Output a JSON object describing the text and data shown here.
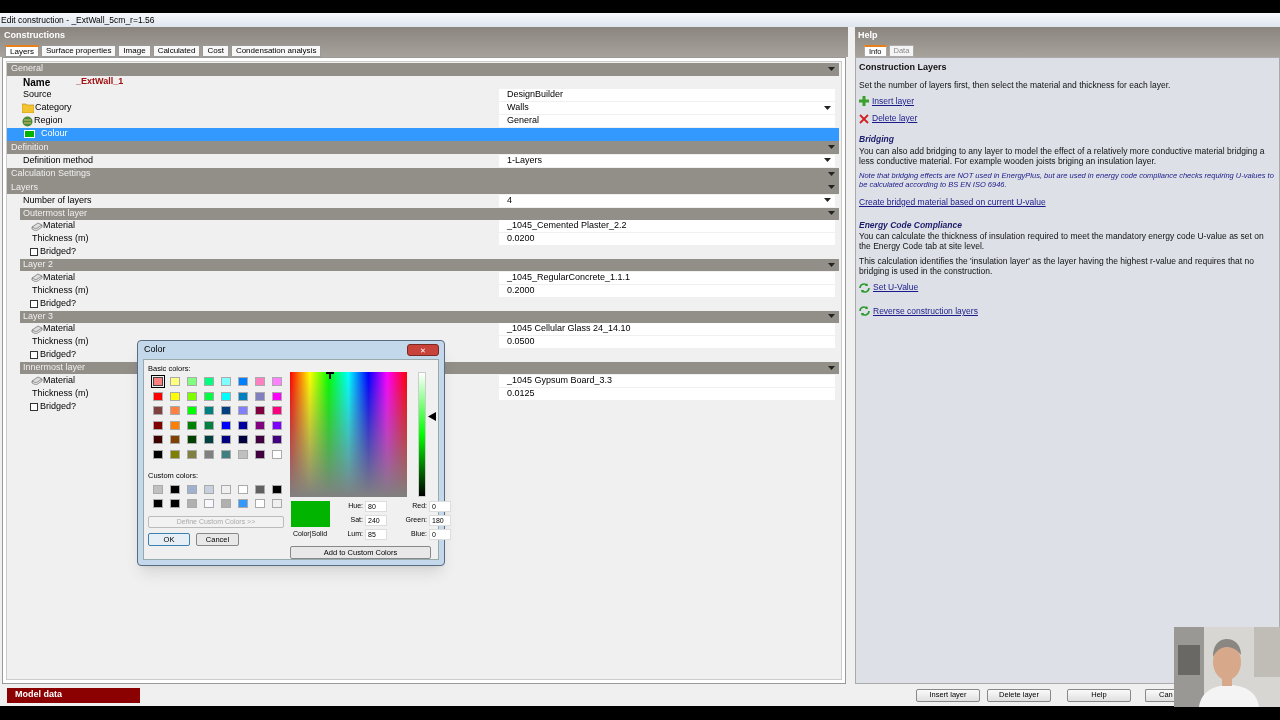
{
  "window": {
    "title": "Edit construction - _ExtWall_5cm_r=1.56"
  },
  "constructions": {
    "title": "Constructions",
    "tabs": [
      {
        "label": "Layers",
        "selected": true
      },
      {
        "label": "Surface properties",
        "selected": false
      },
      {
        "label": "Image",
        "selected": false
      },
      {
        "label": "Calculated",
        "selected": false
      },
      {
        "label": "Cost",
        "selected": false
      },
      {
        "label": "Condensation analysis",
        "selected": false
      }
    ],
    "rows": [
      {
        "kind": "section",
        "label": "General"
      },
      {
        "kind": "name",
        "label": "Name",
        "value": "_ExtWall_1"
      },
      {
        "kind": "field",
        "label": "Source",
        "value": "DesignBuilder"
      },
      {
        "kind": "category",
        "label": "Category",
        "value": "Walls",
        "dropdown": true
      },
      {
        "kind": "region",
        "label": "Region",
        "value": "General"
      },
      {
        "kind": "colour",
        "label": "Colour",
        "color": "#00b400",
        "selected": true
      },
      {
        "kind": "section",
        "label": "Definition"
      },
      {
        "kind": "field",
        "label": "Definition method",
        "value": "1-Layers",
        "dropdown": true
      },
      {
        "kind": "section",
        "label": "Calculation Settings"
      },
      {
        "kind": "section",
        "label": "Layers"
      },
      {
        "kind": "field",
        "label": "Number of layers",
        "value": "4",
        "dropdown": true
      },
      {
        "kind": "subsection",
        "label": "Outermost layer"
      },
      {
        "kind": "material",
        "label": "Material",
        "value": "_1045_Cemented Plaster_2.2"
      },
      {
        "kind": "thickness",
        "label": "Thickness (m)",
        "value": "0.0200"
      },
      {
        "kind": "checkbox",
        "label": "Bridged?",
        "checked": false
      },
      {
        "kind": "subsection",
        "label": "Layer 2"
      },
      {
        "kind": "material",
        "label": "Material",
        "value": "_1045_RegularConcrete_1.1.1"
      },
      {
        "kind": "thickness",
        "label": "Thickness (m)",
        "value": "0.2000"
      },
      {
        "kind": "checkbox",
        "label": "Bridged?",
        "checked": false
      },
      {
        "kind": "subsection",
        "label": "Layer 3"
      },
      {
        "kind": "material",
        "label": "Material",
        "value": "_1045 Cellular Glass 24_14.10"
      },
      {
        "kind": "thickness",
        "label": "Thickness (m)",
        "value": "0.0500"
      },
      {
        "kind": "checkbox",
        "label": "Bridged?",
        "checked": false
      },
      {
        "kind": "subsection",
        "label": "Innermost layer"
      },
      {
        "kind": "material",
        "label": "Material",
        "value": "_1045 Gypsum Board_3.3"
      },
      {
        "kind": "thickness",
        "label": "Thickness (m)",
        "value": "0.0125"
      },
      {
        "kind": "checkbox",
        "label": "Bridged?",
        "checked": false
      }
    ]
  },
  "help": {
    "title": "Help",
    "tabs": [
      {
        "label": "Info",
        "selected": true,
        "disabled": false
      },
      {
        "label": "Data",
        "selected": false,
        "disabled": true
      }
    ],
    "blocks": [
      {
        "kind": "title",
        "text": "Construction Layers"
      },
      {
        "kind": "text",
        "text": "Set the number of layers first, then select the material and thickness for each layer."
      },
      {
        "kind": "add-link",
        "text": "Insert layer"
      },
      {
        "kind": "delete-link",
        "text": "Delete layer"
      },
      {
        "kind": "heading",
        "text": "Bridging"
      },
      {
        "kind": "para",
        "text": "You can also add bridging to any layer to model the effect of a relatively more conductive material bridging a less conductive material.  For example wooden joists briging an insulation layer."
      },
      {
        "kind": "note",
        "text": "Note that bridging effects are NOT used in EnergyPlus, but are used in energy code compliance checks requiring U-values to be calculated according to BS EN ISO 6946."
      },
      {
        "kind": "link",
        "text": "Create bridged material based on current U-value"
      },
      {
        "kind": "heading",
        "text": "Energy Code Compliance"
      },
      {
        "kind": "para",
        "text": "You can calculate the thickness of insulation required to meet the mandatory energy code U-value as set on the Energy Code tab at site level."
      },
      {
        "kind": "text",
        "text": "This calculation identifies the 'insulation layer' as the layer having the highest r-value and requires that no bridging is used in the construction."
      },
      {
        "kind": "refresh-link",
        "text": "Set U-Value"
      },
      {
        "kind": "refresh-link",
        "text": "Reverse construction layers"
      }
    ]
  },
  "color_dialog": {
    "title": "Color",
    "close": "✕",
    "basic_label": "Basic colors:",
    "basic_colors": [
      {
        "color": "#ff8080",
        "selected": true
      },
      {
        "color": "#ffff80",
        "selected": false
      },
      {
        "color": "#80ff80",
        "selected": false
      },
      {
        "color": "#00ff80",
        "selected": false
      },
      {
        "color": "#80ffff",
        "selected": false
      },
      {
        "color": "#0080ff",
        "selected": false
      },
      {
        "color": "#ff80c0",
        "selected": false
      },
      {
        "color": "#ff80ff",
        "selected": false
      },
      {
        "color": "#ff0000",
        "selected": false
      },
      {
        "color": "#ffff00",
        "selected": false
      },
      {
        "color": "#80ff00",
        "selected": false
      },
      {
        "color": "#00ff40",
        "selected": false
      },
      {
        "color": "#00ffff",
        "selected": false
      },
      {
        "color": "#0080c0",
        "selected": false
      },
      {
        "color": "#8080c0",
        "selected": false
      },
      {
        "color": "#ff00ff",
        "selected": false
      },
      {
        "color": "#804040",
        "selected": false
      },
      {
        "color": "#ff8040",
        "selected": false
      },
      {
        "color": "#00ff00",
        "selected": false
      },
      {
        "color": "#008080",
        "selected": false
      },
      {
        "color": "#004080",
        "selected": false
      },
      {
        "color": "#8080ff",
        "selected": false
      },
      {
        "color": "#800040",
        "selected": false
      },
      {
        "color": "#ff0080",
        "selected": false
      },
      {
        "color": "#800000",
        "selected": false
      },
      {
        "color": "#ff8000",
        "selected": false
      },
      {
        "color": "#008000",
        "selected": false
      },
      {
        "color": "#008040",
        "selected": false
      },
      {
        "color": "#0000ff",
        "selected": false
      },
      {
        "color": "#0000a0",
        "selected": false
      },
      {
        "color": "#800080",
        "selected": false
      },
      {
        "color": "#8000ff",
        "selected": false
      },
      {
        "color": "#400000",
        "selected": false
      },
      {
        "color": "#804000",
        "selected": false
      },
      {
        "color": "#004000",
        "selected": false
      },
      {
        "color": "#004040",
        "selected": false
      },
      {
        "color": "#000080",
        "selected": false
      },
      {
        "color": "#000040",
        "selected": false
      },
      {
        "color": "#400040",
        "selected": false
      },
      {
        "color": "#400080",
        "selected": false
      },
      {
        "color": "#000000",
        "selected": false
      },
      {
        "color": "#808000",
        "selected": false
      },
      {
        "color": "#808040",
        "selected": false
      },
      {
        "color": "#808080",
        "selected": false
      },
      {
        "color": "#408080",
        "selected": false
      },
      {
        "color": "#c0c0c0",
        "selected": false
      },
      {
        "color": "#400040",
        "selected": false
      },
      {
        "color": "#ffffff",
        "selected": false
      }
    ],
    "custom_label": "Custom colors:",
    "custom_colors": [
      {
        "color": "#c0c0c0"
      },
      {
        "color": "#000000"
      },
      {
        "color": "#a0b0d0"
      },
      {
        "color": "#c8d0e0"
      },
      {
        "color": "#f0f0f0"
      },
      {
        "color": "#ffffff"
      },
      {
        "color": "#606060"
      },
      {
        "color": "#000000"
      },
      {
        "color": "#000000"
      },
      {
        "color": "#000000"
      },
      {
        "color": "#b0b0b0"
      },
      {
        "color": "#f8f8ff"
      },
      {
        "color": "#b0b0b0"
      },
      {
        "color": "#3399ff"
      },
      {
        "color": "#ffffff"
      },
      {
        "color": "#f0f0f0"
      }
    ],
    "define_button": {
      "label": "Define Custom Colors >>",
      "disabled": true
    },
    "ok": "OK",
    "cancel": "Cancel",
    "swatch_label": "Color|Solid",
    "level": 0.65,
    "fields": [
      {
        "label": "Hue:",
        "value": "80"
      },
      {
        "label": "Red:",
        "value": "0"
      },
      {
        "label": "Sat:",
        "value": "240"
      },
      {
        "label": "Green:",
        "value": "180"
      },
      {
        "label": "Lum:",
        "value": "85"
      },
      {
        "label": "Blue:",
        "value": "0"
      }
    ],
    "add_button": "Add to Custom Colors"
  },
  "bottom_bar": {
    "model_data": "Model data",
    "buttons": [
      "Insert layer",
      "Delete layer",
      "Help",
      "Can"
    ]
  }
}
